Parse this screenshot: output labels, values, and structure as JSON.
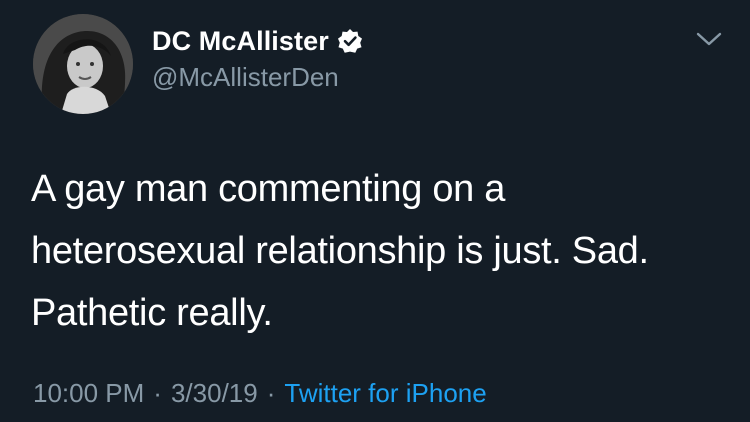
{
  "author": {
    "display_name": "DC McAllister",
    "handle": "@McAllisterDen",
    "verified": true
  },
  "tweet": {
    "lines": [
      "A gay man commenting on a",
      "heterosexual relationship is just. Sad.",
      "Pathetic really."
    ]
  },
  "meta": {
    "time": "10:00 PM",
    "date": "3/30/19",
    "separator": "·",
    "source": "Twitter for iPhone"
  },
  "icons": {
    "verified": "verified-badge-icon",
    "more": "chevron-down-icon"
  },
  "colors": {
    "background": "#141d26",
    "text": "#ffffff",
    "secondary_text": "#8899a6",
    "link": "#1da1f2"
  }
}
